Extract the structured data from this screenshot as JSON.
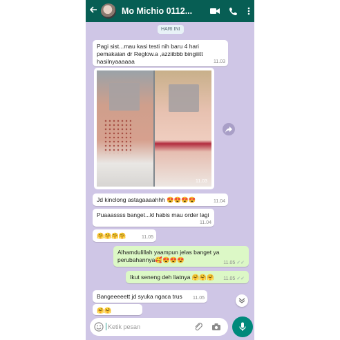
{
  "header": {
    "title": "Mo Michio 0112...",
    "icons": [
      "back-arrow-icon",
      "video-call-icon",
      "phone-icon",
      "more-vert-icon"
    ]
  },
  "date_chip": "HARI INI",
  "messages": [
    {
      "dir": "in",
      "text": "Pagi sist...mau kasi testi nih  baru 4 hari\npemakaian dr Reglow.a ,azziibbb bingiiitt\nhasilnyaaaaaa",
      "time": "11.03"
    },
    {
      "dir": "in",
      "type": "image",
      "time": "11.03"
    },
    {
      "dir": "in",
      "text": "Jd kinclong astagaaaahhh",
      "emoji": "😍😍😍😍",
      "time": "11.04"
    },
    {
      "dir": "in",
      "text": "Puaaassss banget...kl habis mau order lagi",
      "time": "11.04"
    },
    {
      "dir": "in",
      "text": "",
      "emoji": "🤗🤗🤗🤗",
      "time": "11.05"
    },
    {
      "dir": "out",
      "text": "Alhamdulillah yaampun jelas banget ya\nperubahannya",
      "emoji": "🥰😍😍😍",
      "time": "11.05"
    },
    {
      "dir": "out",
      "text": "Ikut seneng deh liatnya",
      "emoji": "🤗🤗🤗",
      "time": "11.05"
    },
    {
      "dir": "in",
      "text": "Bangeeeeett jd syuka ngaca trus",
      "time": "11.05"
    },
    {
      "dir": "in",
      "text": "",
      "emoji": "🤗🤗",
      "time": ""
    }
  ],
  "input": {
    "placeholder": "Ketik pesan"
  },
  "colors": {
    "header": "#075e54",
    "background": "#cfc6e6",
    "outgoing": "#dcf8c6",
    "incoming": "#ffffff",
    "accent": "#00897b"
  }
}
